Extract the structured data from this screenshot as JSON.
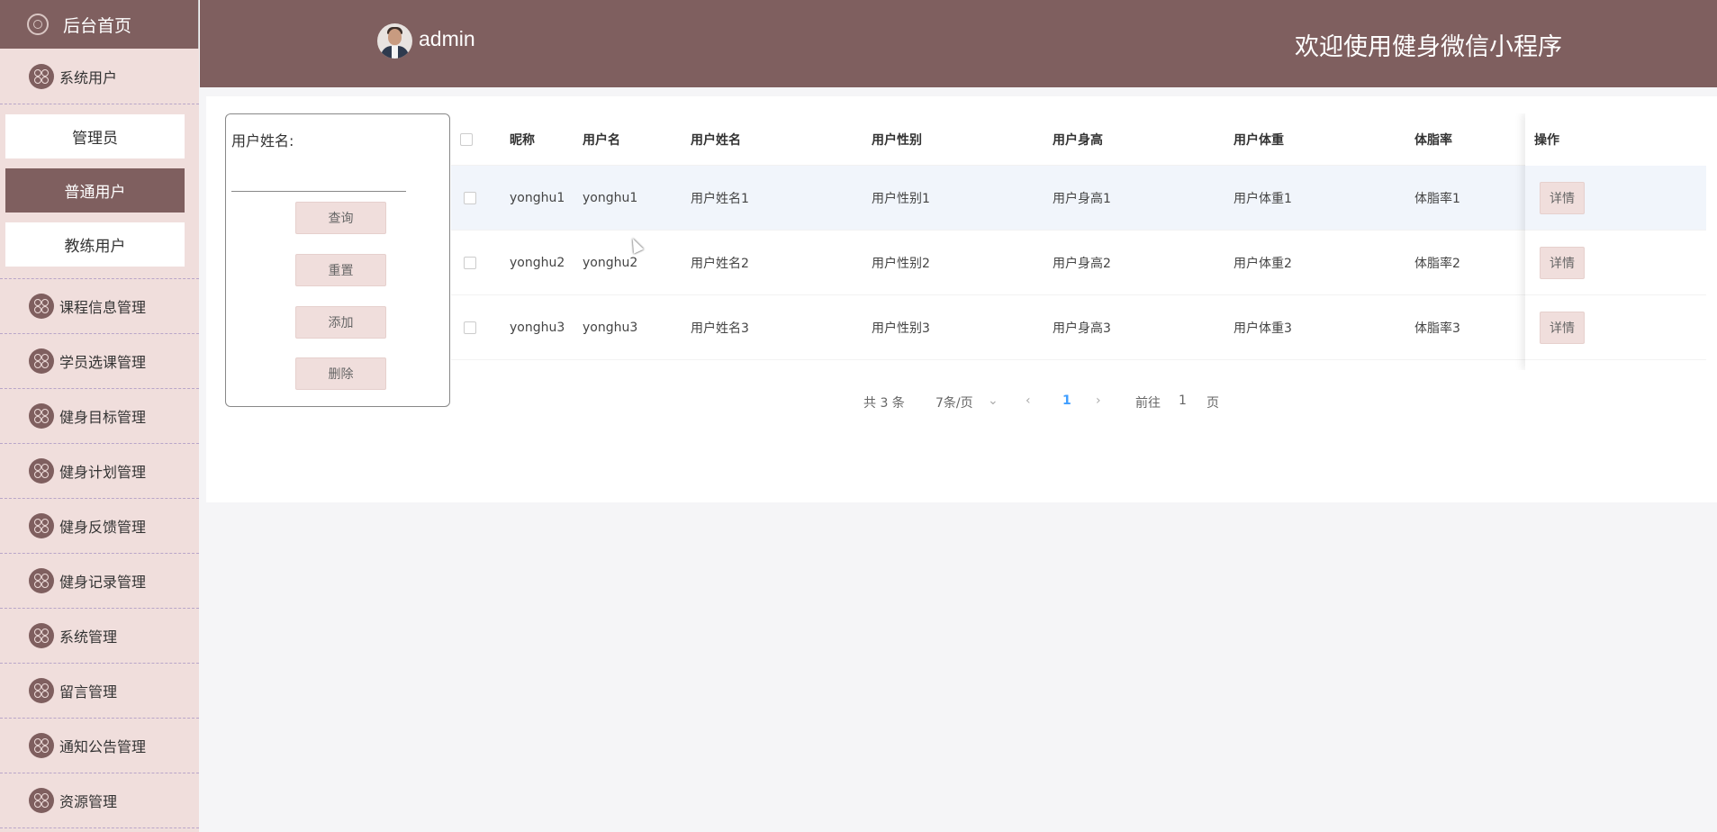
{
  "sidebar": {
    "home": "后台首页",
    "system_users": "系统用户",
    "sub_items": [
      "管理员",
      "普通用户",
      "教练用户"
    ],
    "items": [
      "课程信息管理",
      "学员选课管理",
      "健身目标管理",
      "健身计划管理",
      "健身反馈管理",
      "健身记录管理",
      "系统管理",
      "留言管理",
      "通知公告管理",
      "资源管理"
    ]
  },
  "header": {
    "username": "admin",
    "title": "欢迎使用健身微信小程序"
  },
  "search": {
    "label": "用户姓名:",
    "value": "",
    "buttons": {
      "query": "查询",
      "reset": "重置",
      "add": "添加",
      "delete": "删除"
    }
  },
  "table": {
    "headers": {
      "nickname": "昵称",
      "username": "用户名",
      "realname": "用户姓名",
      "gender": "用户性别",
      "height": "用户身高",
      "weight": "用户体重",
      "bodyfat": "体脂率",
      "ops": "操作"
    },
    "rows": [
      {
        "nickname": "yonghu1",
        "username": "yonghu1",
        "realname": "用户姓名1",
        "gender": "用户性别1",
        "height": "用户身高1",
        "weight": "用户体重1",
        "bodyfat": "体脂率1",
        "action": "详情"
      },
      {
        "nickname": "yonghu2",
        "username": "yonghu2",
        "realname": "用户姓名2",
        "gender": "用户性别2",
        "height": "用户身高2",
        "weight": "用户体重2",
        "bodyfat": "体脂率2",
        "action": "详情"
      },
      {
        "nickname": "yonghu3",
        "username": "yonghu3",
        "realname": "用户姓名3",
        "gender": "用户性别3",
        "height": "用户身高3",
        "weight": "用户体重3",
        "bodyfat": "体脂率3",
        "action": "详情"
      }
    ]
  },
  "pagination": {
    "total": "共 3 条",
    "page_size": "7条/页",
    "current": "1",
    "goto_prefix": "前往",
    "goto_value": "1",
    "goto_suffix": "页"
  },
  "colors": {
    "brand": "#7f5f5f",
    "sidebar_bg": "#f0dedc",
    "accent": "#409eff"
  }
}
